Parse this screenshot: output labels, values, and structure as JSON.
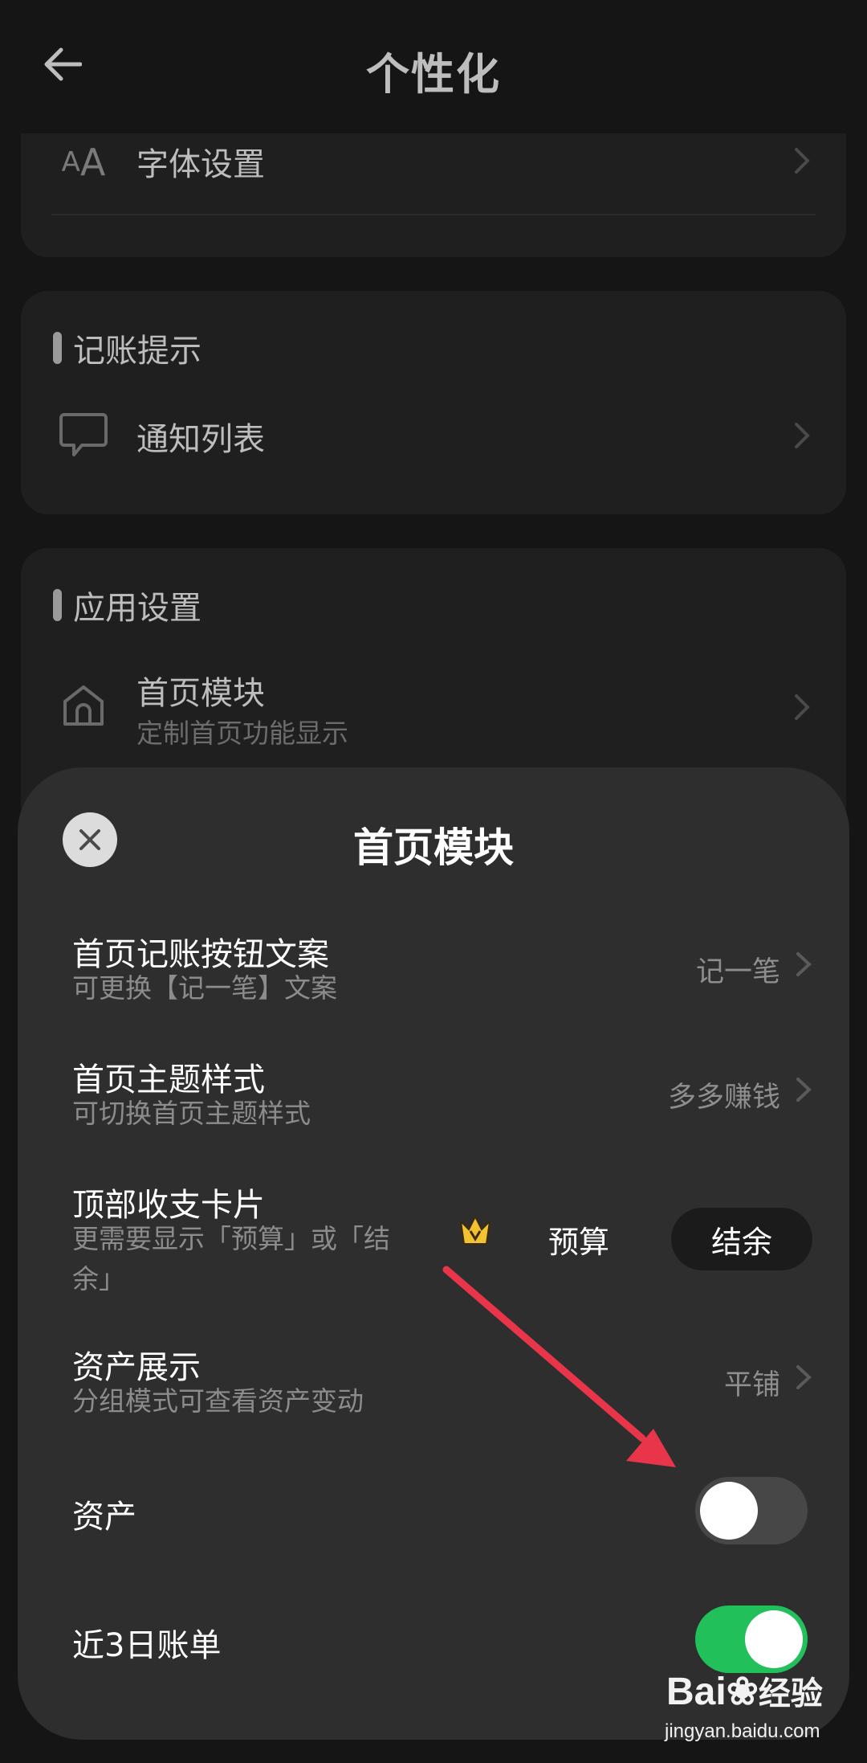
{
  "header": {
    "title": "个性化"
  },
  "background": {
    "font_row": {
      "icon_text": "AA",
      "label": "字体设置"
    },
    "reminder_section": {
      "title": "记账提示",
      "items": [
        {
          "label": "通知列表"
        }
      ]
    },
    "app_section": {
      "title": "应用设置",
      "items": [
        {
          "label": "首页模块",
          "sub": "定制首页功能显示"
        }
      ]
    }
  },
  "sheet": {
    "title": "首页模块",
    "options": [
      {
        "title": "首页记账按钮文案",
        "sub": "可更换【记一笔】文案",
        "value": "记一笔"
      },
      {
        "title": "首页主题样式",
        "sub": "可切换首页主题样式",
        "value": "多多赚钱"
      },
      {
        "title": "顶部收支卡片",
        "sub_line1": "更需要显示「预算」或「结",
        "sub_line2": "余」",
        "segments": [
          "预算",
          "结余"
        ],
        "selected": "结余"
      },
      {
        "title": "资产展示",
        "sub": "分组模式可查看资产变动",
        "value": "平铺"
      },
      {
        "title": "资产",
        "toggle_on": false
      },
      {
        "title": "近3日账单",
        "toggle_on": true
      }
    ]
  },
  "watermark": {
    "logo": "Bai",
    "logo2": "经验",
    "url": "jingyan.baidu.com"
  },
  "colors": {
    "toggle_on": "#21c05b",
    "arrow": "#e8354a",
    "crown": "#f2c230"
  }
}
